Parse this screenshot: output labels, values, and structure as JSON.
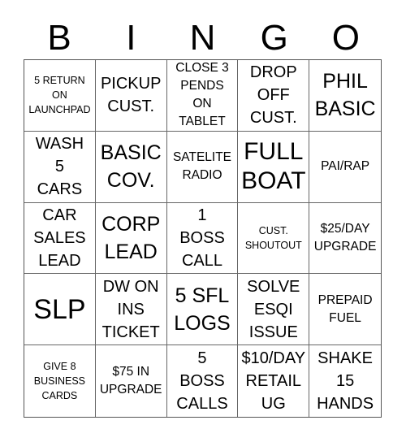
{
  "header": {
    "letters": [
      "B",
      "I",
      "N",
      "G",
      "O"
    ]
  },
  "board": {
    "rows": [
      [
        "5 RETURN\nON\nLAUNCHPAD",
        "PICKUP\nCUST.",
        "CLOSE 3\nPENDS\nON\nTABLET",
        "DROP\nOFF\nCUST.",
        "PHIL\nBASIC"
      ],
      [
        "WASH\n5\nCARS",
        "BASIC\nCOV.",
        "SATELITE\nRADIO",
        "FULL\nBOAT",
        "PAI/RAP"
      ],
      [
        "CAR\nSALES\nLEAD",
        "CORP\nLEAD",
        "1\nBOSS\nCALL",
        "CUST.\nSHOUTOUT",
        "$25/DAY\nUPGRADE"
      ],
      [
        "SLP",
        "DW ON\nINS\nTICKET",
        "5 SFL\nLOGS",
        "SOLVE\nESQI\nISSUE",
        "PREPAID\nFUEL"
      ],
      [
        "GIVE 8\nBUSINESS\nCARDS",
        "$75 IN\nUPGRADE",
        "5\nBOSS\nCALLS",
        "$10/DAY\nRETAIL\nUG",
        "SHAKE\n15\nHANDS"
      ]
    ]
  }
}
